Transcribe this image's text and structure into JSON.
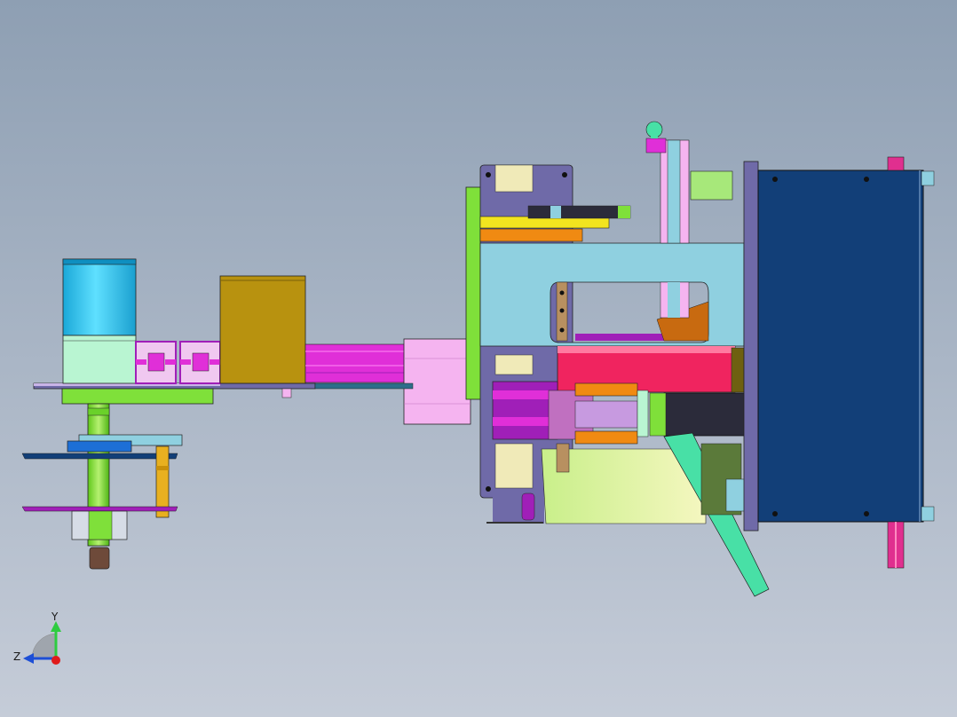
{
  "viewport": {
    "background_top": "#8e9fb3",
    "background_bottom": "#c5ccd8"
  },
  "triad": {
    "y_label": "Y",
    "z_label": "Z",
    "colors": {
      "y_axis": "#2ecc40",
      "z_axis": "#1d4fd6",
      "origin": "#e01b1b"
    }
  },
  "palette": {
    "motor_cyan": "#29c3ef",
    "motor_base": "#b9f5d2",
    "lime": "#7fe03a",
    "magenta": "#e02fd8",
    "light_pink": "#f5b4f0",
    "gold": "#b8920f",
    "sky": "#8fd0e0",
    "hot_pink": "#f0245f",
    "navy": "#123f78",
    "purple_slate": "#6f6aa8",
    "orange": "#f08a12",
    "violet": "#a01fb8",
    "dark_cab": "#2b2b3a",
    "mint": "#48e0a6",
    "yellow": "#f2e41f",
    "brown": "#8b6a3c"
  }
}
